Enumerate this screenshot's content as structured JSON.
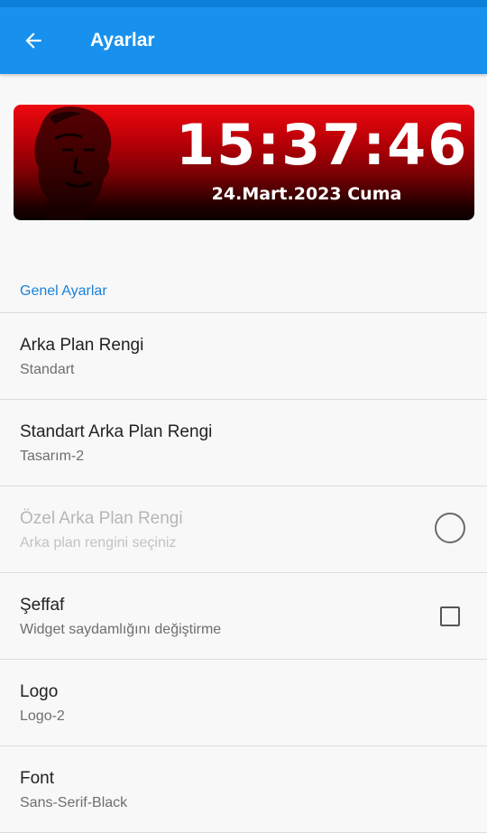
{
  "app_bar": {
    "title": "Ayarlar",
    "back_icon": "arrow-left-icon",
    "color": "#1891ee"
  },
  "widget": {
    "time": "15:37:46",
    "date": "24.Mart.2023 Cuma",
    "portrait_icon": "portrait-silhouette",
    "gradient_top": "#ee0a10",
    "gradient_bottom": "#0a0000"
  },
  "section": {
    "title": "Genel Ayarlar",
    "color": "#1a82d8"
  },
  "preferences": [
    {
      "title": "Arka Plan Rengi",
      "summary": "Standart",
      "control": "none",
      "enabled": true
    },
    {
      "title": "Standart Arka Plan Rengi",
      "summary": "Tasarım-2",
      "control": "none",
      "enabled": true
    },
    {
      "title": "Özel Arka Plan Rengi",
      "summary": "Arka plan rengini seçiniz",
      "control": "color-circle",
      "enabled": false
    },
    {
      "title": "Şeffaf",
      "summary": "Widget saydamlığını değiştirme",
      "control": "checkbox",
      "checked": false,
      "enabled": true
    },
    {
      "title": "Logo",
      "summary": "Logo-2",
      "control": "none",
      "enabled": true
    },
    {
      "title": "Font",
      "summary": "Sans-Serif-Black",
      "control": "none",
      "enabled": true
    }
  ]
}
